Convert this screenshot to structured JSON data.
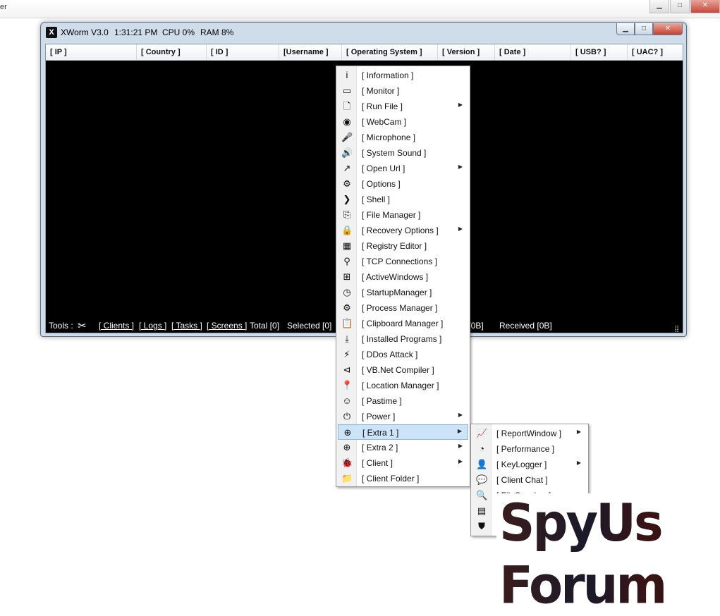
{
  "background": {
    "fragment_text": "er"
  },
  "window": {
    "app_icon_letter": "X",
    "app_name": "XWorm V3.0",
    "time": "1:31:21 PM",
    "cpu": "CPU 0%",
    "ram": "RAM 8%",
    "buttons": {
      "minimize": "▁",
      "maximize": "□",
      "close": "✕"
    }
  },
  "columns": [
    "[ IP ]",
    "[ Country ]",
    "[ ID ]",
    "[Username ]",
    "[ Operating System ]",
    "[ Version ]",
    "[ Date ]",
    "[ USB? ]",
    "[ UAC? ]"
  ],
  "status_bar": {
    "tools_label": "Tools :",
    "clients": "[ Clients ]",
    "logs": "[ Logs ]",
    "tasks": "[ Tasks ]",
    "screens": "[ Screens ]",
    "total": "Total [0]",
    "selected": "Selected [0]",
    "sent_fragment": "nt [0B]",
    "received": "Received [0B]"
  },
  "context_menu": {
    "items": [
      {
        "label": "[ Information ]",
        "icon": "info-icon",
        "glyph": "i",
        "submenu": false
      },
      {
        "label": "[ Monitor ]",
        "icon": "monitor-icon",
        "glyph": "▭",
        "submenu": false
      },
      {
        "label": "[ Run File ]",
        "icon": "file-icon",
        "glyph": "🗋",
        "submenu": true
      },
      {
        "label": "[ WebCam ]",
        "icon": "webcam-icon",
        "glyph": "◉",
        "submenu": false
      },
      {
        "label": "[ Microphone ]",
        "icon": "microphone-icon",
        "glyph": "🎤",
        "submenu": false
      },
      {
        "label": "[ System Sound ]",
        "icon": "speaker-icon",
        "glyph": "🔊",
        "submenu": false
      },
      {
        "label": "[ Open Url ]",
        "icon": "external-link-icon",
        "glyph": "↗",
        "submenu": true
      },
      {
        "label": "[ Options ]",
        "icon": "gear-icon",
        "glyph": "⚙",
        "submenu": false
      },
      {
        "label": "[ Shell ]",
        "icon": "terminal-icon",
        "glyph": "❯",
        "submenu": false
      },
      {
        "label": "[ File Manager ]",
        "icon": "files-icon",
        "glyph": "⎘",
        "submenu": false
      },
      {
        "label": "[ Recovery Options ]",
        "icon": "lock-icon",
        "glyph": "🔒",
        "submenu": true
      },
      {
        "label": "[ Registry Editor ]",
        "icon": "registry-icon",
        "glyph": "▦",
        "submenu": false
      },
      {
        "label": "[ TCP Connections ]",
        "icon": "network-icon",
        "glyph": "⚲",
        "submenu": false
      },
      {
        "label": "[ ActiveWindows ]",
        "icon": "windows-icon",
        "glyph": "⊞",
        "submenu": false
      },
      {
        "label": "[ StartupManager ]",
        "icon": "clock-icon",
        "glyph": "◷",
        "submenu": false
      },
      {
        "label": "[ Process Manager ]",
        "icon": "cog-icon",
        "glyph": "⚙",
        "submenu": false
      },
      {
        "label": "[ Clipboard Manager ]",
        "icon": "clipboard-icon",
        "glyph": "📋",
        "submenu": false
      },
      {
        "label": "[ Installed Programs ]",
        "icon": "download-icon",
        "glyph": "⤓",
        "submenu": false
      },
      {
        "label": "[ DDos Attack ]",
        "icon": "lightning-icon",
        "glyph": "⚡",
        "submenu": false
      },
      {
        "label": "[ VB.Net Compiler ]",
        "icon": "visual-studio-icon",
        "glyph": "⊲",
        "submenu": false
      },
      {
        "label": "[ Location Manager ]",
        "icon": "map-pin-icon",
        "glyph": "📍",
        "submenu": false
      },
      {
        "label": "[ Pastime ]",
        "icon": "smiley-icon",
        "glyph": "☺",
        "submenu": false
      },
      {
        "label": "[ Power ]",
        "icon": "power-icon",
        "glyph": "⏻",
        "submenu": true
      },
      {
        "label": "[ Extra 1 ]",
        "icon": "plus-circle-icon",
        "glyph": "⊕",
        "submenu": true,
        "highlighted": true
      },
      {
        "label": "[ Extra 2 ]",
        "icon": "plus-circle-icon",
        "glyph": "⊕",
        "submenu": true
      },
      {
        "label": "[ Client ]",
        "icon": "bug-icon",
        "glyph": "🐞",
        "submenu": true
      },
      {
        "label": "[ Client Folder ]",
        "icon": "folder-icon",
        "glyph": "📁",
        "submenu": false
      }
    ]
  },
  "submenu_extra1": {
    "items": [
      {
        "label": "[ ReportWindow ]",
        "icon": "report-icon",
        "glyph": "📈",
        "submenu": true
      },
      {
        "label": "[ Performance ]",
        "icon": "gauge-icon",
        "glyph": "◔",
        "submenu": false
      },
      {
        "label": "[ KeyLogger ]",
        "icon": "spy-icon",
        "glyph": "👤",
        "submenu": true
      },
      {
        "label": "[ Client Chat ]",
        "icon": "chat-icon",
        "glyph": "💬",
        "submenu": false
      },
      {
        "label": "[ FileSeacher ]",
        "icon": "search-icon",
        "glyph": "🔍",
        "submenu": false
      },
      {
        "label": "[",
        "icon": "message-icon",
        "glyph": "▤",
        "submenu": false
      },
      {
        "label": "[",
        "icon": "shield-icon",
        "glyph": "⛊",
        "submenu": false
      }
    ]
  },
  "watermark": {
    "text": "SpyUs Forum"
  }
}
